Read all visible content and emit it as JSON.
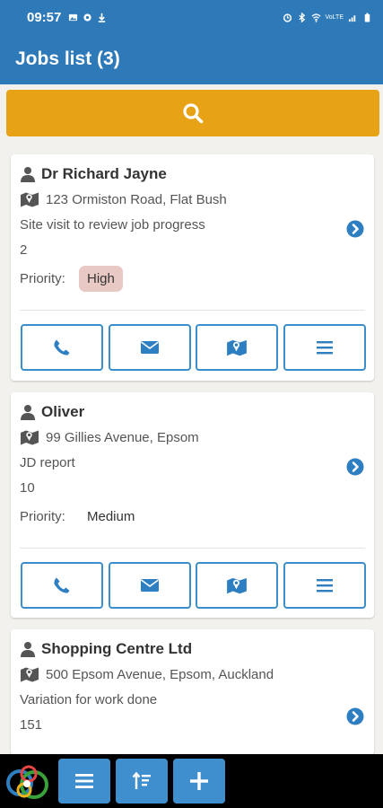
{
  "status_bar": {
    "time": "09:57",
    "left_icons": [
      "gallery-icon",
      "settings-icon",
      "download-icon"
    ],
    "right_icons": [
      "alarm-icon",
      "bluetooth-icon",
      "wifi-icon",
      "volte-icon",
      "signal-icon",
      "battery-icon"
    ],
    "network_label": "VoLTE"
  },
  "header": {
    "title": "Jobs list (3)"
  },
  "search": {
    "icon": "search-icon",
    "color": "#e8a215"
  },
  "colors": {
    "header": "#2e79b8",
    "accent": "#3b8ec9",
    "high_priority_bg": "#e8c9c4"
  },
  "priority_label": "Priority:",
  "jobs": [
    {
      "name": "Dr Richard Jayne",
      "address": "123 Ormiston Road, Flat Bush",
      "description": "Site visit to review job progress",
      "count": "2",
      "priority": "High"
    },
    {
      "name": "Oliver",
      "address": "99 Gillies Avenue, Epsom",
      "description": "JD report",
      "count": "10",
      "priority": "Medium"
    },
    {
      "name": "Shopping Centre Ltd",
      "address": "500 Epsom Avenue, Epsom, Auckland",
      "description": "Variation for work done",
      "count": "151"
    }
  ],
  "card_actions": [
    "phone-icon",
    "email-icon",
    "map-icon",
    "menu-icon"
  ],
  "bottom_bar": {
    "logo": "app-logo",
    "buttons": [
      "menu-icon",
      "sort-icon",
      "add-icon"
    ]
  }
}
